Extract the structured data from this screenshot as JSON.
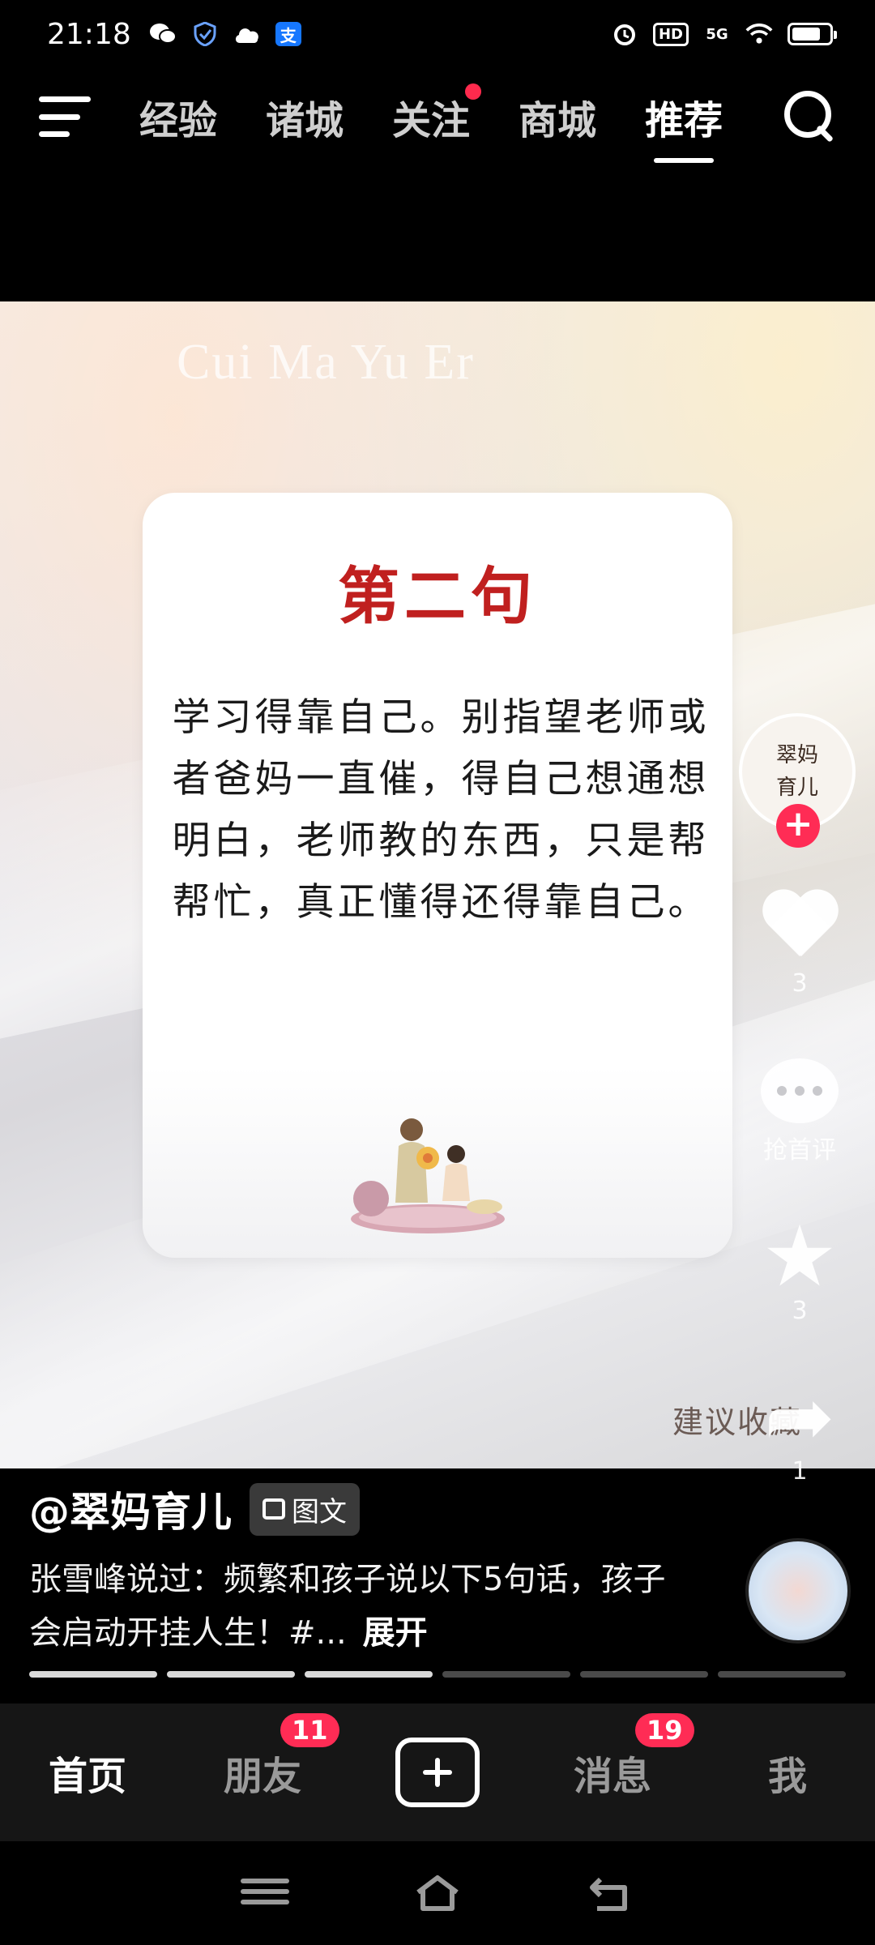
{
  "status_bar": {
    "time": "21:18",
    "left_icons": [
      "wechat-icon",
      "shield-icon",
      "cloud-icon",
      "alipay-icon"
    ],
    "right_icons": [
      "alarm-icon",
      "hd-icon",
      "5g-signal-icon",
      "wifi-icon",
      "battery-icon"
    ],
    "hd_label": "HD",
    "network_label": "5G",
    "alipay_glyph": "支"
  },
  "top_nav": {
    "tabs": [
      {
        "label": "经验"
      },
      {
        "label": "诸城"
      },
      {
        "label": "关注",
        "dot": true
      },
      {
        "label": "商城"
      },
      {
        "label": "推荐",
        "active": true
      }
    ]
  },
  "post": {
    "watermark": "Cui Ma Yu Er",
    "card_title": "第二句",
    "card_body": "学习得靠自己。别指望老师或者爸妈一直催，得自己想通想明白，老师教的东西，只是帮帮忙，真正懂得还得靠自己。",
    "suggest_text": "建议收藏"
  },
  "actions": {
    "avatar_text_line1": "翠妈",
    "avatar_text_line2": "育儿",
    "likes": "3",
    "comments_label": "抢首评",
    "favorites": "3",
    "shares": "1"
  },
  "info": {
    "author": "@翠妈育儿",
    "type_badge": "图文",
    "description": "张雪峰说过：频繁和孩子说以下5句话，孩子会启动开挂人生！#...",
    "expand_label": "展开",
    "progress_total": 6,
    "progress_done": 3
  },
  "bottom_tabs": {
    "home": "首页",
    "friends": "朋友",
    "friends_badge": "11",
    "messages": "消息",
    "messages_badge": "19",
    "me": "我"
  },
  "colors": {
    "accent_red": "#ff2c55",
    "title_red": "#c0201f"
  }
}
